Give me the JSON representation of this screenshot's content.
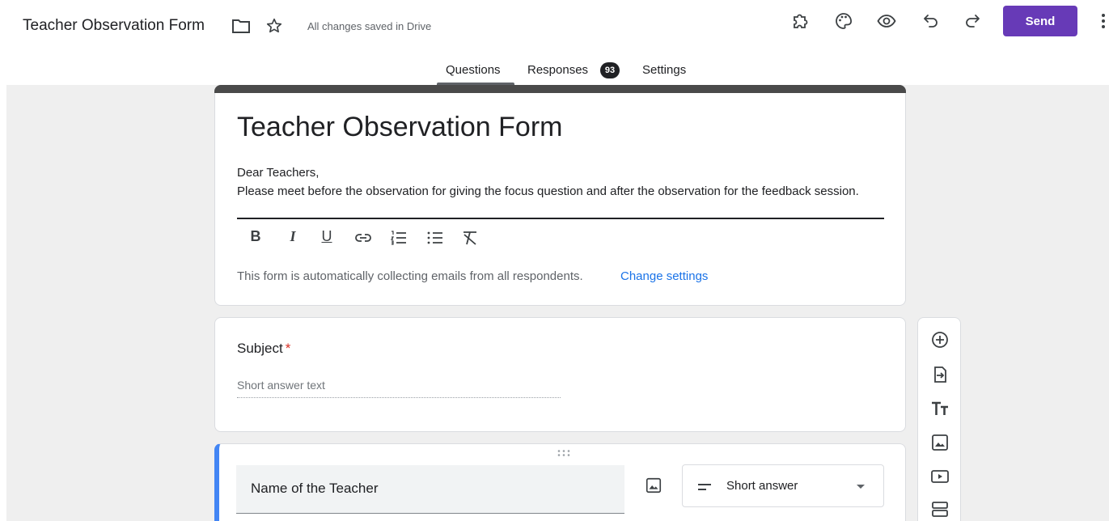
{
  "header": {
    "doc_title": "Teacher Observation Form",
    "save_status": "All changes saved in Drive",
    "send_label": "Send",
    "icons": [
      "folder-icon",
      "star-icon",
      "addons-icon",
      "palette-icon",
      "preview-icon",
      "undo-icon",
      "redo-icon",
      "more-vert-icon"
    ]
  },
  "tabs": {
    "questions": "Questions",
    "responses": "Responses",
    "responses_count": "93",
    "settings": "Settings"
  },
  "form": {
    "title": "Teacher Observation Form",
    "description_line1": "Dear Teachers,",
    "description_line2": "Please meet before the observation for giving the focus question and after the observation for the feedback session.",
    "format_labels": {
      "bold": "B",
      "italic": "I",
      "underline": "U"
    },
    "collect_notice": "This form is automatically collecting emails from all respondents.",
    "change_settings": "Change settings"
  },
  "questions": [
    {
      "title": "Subject",
      "required_mark": "*",
      "placeholder": "Short answer text"
    },
    {
      "title": "Name of the Teacher",
      "type": "Short answer"
    }
  ],
  "colors": {
    "accent": "#673ab7",
    "active_question": "#4285f4",
    "link": "#1a73e8",
    "required": "#d93025"
  }
}
